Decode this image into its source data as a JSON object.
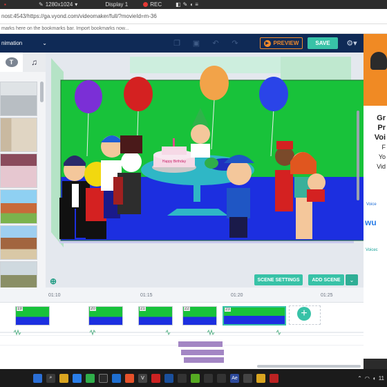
{
  "recorder": {
    "resolution": "1280x1024",
    "display": "Display 1",
    "rec_label": "REC"
  },
  "browser": {
    "url": "nost:4543/https://ga.vyond.com/videomaker/full/?movieId=m-36",
    "bookmarks_hint": "marks here on the bookmarks bar. Import bookmarks now..."
  },
  "app": {
    "title": "nimation",
    "preview_label": "PREVIEW",
    "save_label": "SAVE"
  },
  "stage": {
    "cake_text": "Happy Birthday",
    "scene_settings_label": "SCENE SETTINGS",
    "add_scene_label": "ADD SCENE"
  },
  "timeline": {
    "ticks": [
      "01:10",
      "01:15",
      "01:20",
      "01:25"
    ],
    "scene_numbers": [
      "19",
      "20",
      "21",
      "22",
      "23"
    ]
  },
  "ad": {
    "line1": "Gr",
    "line2": "Pr",
    "line3": "Voi",
    "line4": "F",
    "line5": "Yo",
    "line6": "Vid",
    "logo1": "Voice",
    "logo2": "wu",
    "logo3": "Voicec"
  },
  "taskbar": {
    "time": "11"
  },
  "colors": {
    "app_header": "#0f2a56",
    "accent": "#38c2a7",
    "preview": "#f18a2b",
    "stage_wall": "#18c23a",
    "stage_floor": "#1c2fe0"
  }
}
